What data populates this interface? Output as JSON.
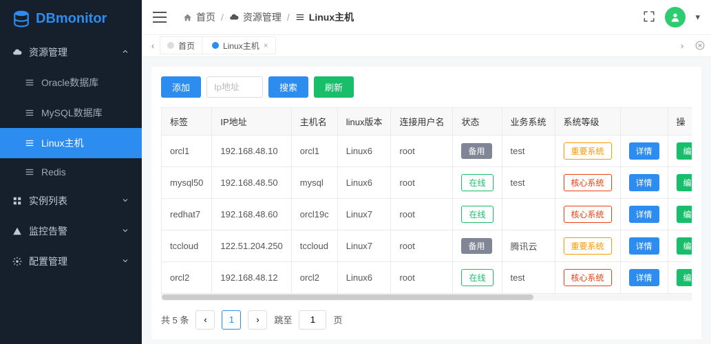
{
  "logo": "DBmonitor",
  "sidebar": {
    "groups": [
      {
        "label": "资源管理",
        "icon": "cloud",
        "expanded": true,
        "items": [
          {
            "label": "Oracle数据库",
            "icon": "menu-lines"
          },
          {
            "label": "MySQL数据库",
            "icon": "menu-lines"
          },
          {
            "label": "Linux主机",
            "icon": "menu-lines",
            "active": true
          },
          {
            "label": "Redis",
            "icon": "menu-lines"
          }
        ]
      },
      {
        "label": "实例列表",
        "icon": "grid",
        "expanded": false
      },
      {
        "label": "监控告警",
        "icon": "triangle",
        "expanded": false
      },
      {
        "label": "配置管理",
        "icon": "gear",
        "expanded": false
      }
    ]
  },
  "breadcrumb": {
    "items": [
      {
        "label": "首页",
        "icon": "home"
      },
      {
        "label": "资源管理",
        "icon": "cloud"
      },
      {
        "label": "Linux主机",
        "icon": "menu-lines",
        "current": true
      }
    ],
    "sep": "/"
  },
  "tabs": [
    {
      "label": "首页",
      "active": false
    },
    {
      "label": "Linux主机",
      "active": true,
      "closable": true
    }
  ],
  "toolbar": {
    "add_label": "添加",
    "search_placeholder": "Ip地址",
    "search_label": "搜索",
    "refresh_label": "刷新"
  },
  "table": {
    "columns": [
      "标签",
      "IP地址",
      "主机名",
      "linux版本",
      "连接用户名",
      "状态",
      "业务系统",
      "系统等级",
      "",
      "操"
    ],
    "rows": [
      {
        "tag": "orcl1",
        "ip": "192.168.48.10",
        "host": "orcl1",
        "ver": "Linux6",
        "user": "root",
        "status": "备用",
        "biz": "test",
        "level": "重要系统",
        "status_class": "gray",
        "level_class": "orange"
      },
      {
        "tag": "mysql50",
        "ip": "192.168.48.50",
        "host": "mysql",
        "ver": "Linux6",
        "user": "root",
        "status": "在线",
        "biz": "test",
        "level": "核心系统",
        "status_class": "green",
        "level_class": "red"
      },
      {
        "tag": "redhat7",
        "ip": "192.168.48.60",
        "host": "orcl19c",
        "ver": "Linux7",
        "user": "root",
        "status": "在线",
        "biz": "",
        "level": "核心系统",
        "status_class": "green",
        "level_class": "red"
      },
      {
        "tag": "tccloud",
        "ip": "122.51.204.250",
        "host": "tccloud",
        "ver": "Linux7",
        "user": "root",
        "status": "备用",
        "biz": "腾讯云",
        "level": "重要系统",
        "status_class": "gray",
        "level_class": "orange"
      },
      {
        "tag": "orcl2",
        "ip": "192.168.48.12",
        "host": "orcl2",
        "ver": "Linux6",
        "user": "root",
        "status": "在线",
        "biz": "test",
        "level": "核心系统",
        "status_class": "green",
        "level_class": "red"
      }
    ],
    "action_detail": "详情",
    "action_edit": "编"
  },
  "pager": {
    "total_label": "共 5 条",
    "current": "1",
    "jump_label": "跳至",
    "jump_value": "1",
    "page_suffix": "页"
  }
}
